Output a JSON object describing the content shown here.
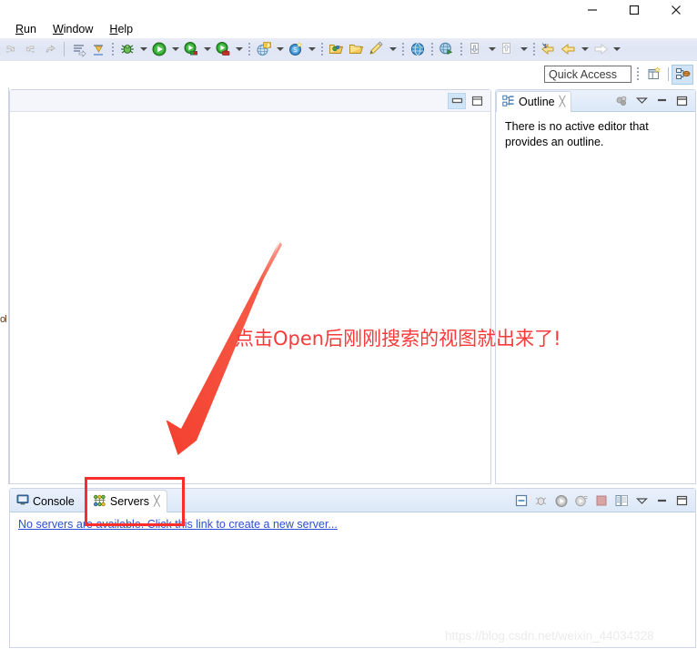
{
  "window": {
    "controls": [
      {
        "name": "minimize-button",
        "glyph": "minimize"
      },
      {
        "name": "maximize-button",
        "glyph": "maximize"
      },
      {
        "name": "close-button",
        "glyph": "close"
      }
    ]
  },
  "menubar": {
    "items": [
      {
        "label": "Run",
        "mnemonic": "R",
        "rest": "un"
      },
      {
        "label": "Window",
        "mnemonic": "W",
        "rest": "indow"
      },
      {
        "label": "Help",
        "mnemonic": "H",
        "rest": "elp"
      }
    ]
  },
  "toolbar": {
    "items": [
      {
        "name": "undo-icon",
        "kind": "icon"
      },
      {
        "name": "redo-icon",
        "kind": "icon"
      },
      {
        "name": "last-edit-location-icon",
        "kind": "icon"
      },
      {
        "name": "separator",
        "kind": "sep-line"
      },
      {
        "name": "next-annotation-icon",
        "kind": "icon"
      },
      {
        "name": "previous-annotation-icon",
        "kind": "icon"
      },
      {
        "name": "separator",
        "kind": "sep-dot"
      },
      {
        "name": "debug-icon",
        "kind": "icon"
      },
      {
        "name": "debug-dropdown-arrow-icon",
        "kind": "arrow"
      },
      {
        "name": "run-icon",
        "kind": "icon"
      },
      {
        "name": "run-dropdown-arrow-icon",
        "kind": "arrow"
      },
      {
        "name": "run-external-tools-icon",
        "kind": "icon"
      },
      {
        "name": "run-external-dropdown-arrow-icon",
        "kind": "arrow"
      },
      {
        "name": "run-on-server-icon",
        "kind": "icon"
      },
      {
        "name": "run-on-server-dropdown-arrow-icon",
        "kind": "arrow"
      },
      {
        "name": "separator",
        "kind": "sep-dot"
      },
      {
        "name": "new-web-project-icon",
        "kind": "icon"
      },
      {
        "name": "new-web-project-dropdown-arrow-icon",
        "kind": "arrow"
      },
      {
        "name": "search-icon",
        "kind": "icon"
      },
      {
        "name": "search-dropdown-arrow-icon",
        "kind": "arrow"
      },
      {
        "name": "separator",
        "kind": "sep-dot"
      },
      {
        "name": "open-type-icon",
        "kind": "icon"
      },
      {
        "name": "open-task-icon",
        "kind": "icon"
      },
      {
        "name": "new-annotation-icon",
        "kind": "icon"
      },
      {
        "name": "new-annotation-dropdown-arrow-icon",
        "kind": "arrow"
      },
      {
        "name": "separator",
        "kind": "sep-dot"
      },
      {
        "name": "open-web-browser-icon",
        "kind": "icon"
      },
      {
        "name": "separator",
        "kind": "sep-dot"
      },
      {
        "name": "open-perspective-icon",
        "kind": "icon"
      },
      {
        "name": "separator",
        "kind": "sep-dot"
      },
      {
        "name": "import-icon",
        "kind": "icon"
      },
      {
        "name": "import-dropdown-arrow-icon",
        "kind": "arrow"
      },
      {
        "name": "export-icon",
        "kind": "icon"
      },
      {
        "name": "export-dropdown-arrow-icon",
        "kind": "arrow"
      },
      {
        "name": "separator",
        "kind": "sep-dot"
      },
      {
        "name": "back-to-icon",
        "kind": "icon"
      },
      {
        "name": "back-icon",
        "kind": "icon"
      },
      {
        "name": "back-dropdown-arrow-icon",
        "kind": "arrow"
      },
      {
        "name": "forward-icon",
        "kind": "icon"
      },
      {
        "name": "forward-dropdown-arrow-icon",
        "kind": "arrow"
      }
    ]
  },
  "quick_access": {
    "placeholder": "Quick Access",
    "value": "Quick Access"
  },
  "perspective_bar": {
    "buttons": [
      {
        "name": "open-perspective-button",
        "active": false
      },
      {
        "name": "java-ee-perspective-button",
        "active": true
      }
    ]
  },
  "left_fast_view": {
    "clipped_label": "ol"
  },
  "editor_area": {
    "controls": [
      {
        "name": "restore-editor-button",
        "glyph": "restore",
        "active": true
      },
      {
        "name": "maximize-editor-button",
        "glyph": "maximize",
        "active": false
      }
    ],
    "body_text": ""
  },
  "outline_view": {
    "tab": {
      "title": "Outline",
      "icon": "outline-icon",
      "close": "╳"
    },
    "tools": [
      {
        "name": "focus-on-selection-icon"
      },
      {
        "name": "view-menu-icon"
      },
      {
        "name": "minimize-view-icon"
      },
      {
        "name": "maximize-view-icon"
      }
    ],
    "message": "There is no active editor that provides an outline."
  },
  "bottom_view": {
    "tabs": [
      {
        "label": "Console",
        "icon": "console-icon",
        "active": false,
        "closable": false
      },
      {
        "label": "Servers",
        "icon": "servers-icon",
        "active": true,
        "closable": true,
        "close": "╳"
      }
    ],
    "tools": [
      {
        "name": "new-server-icon"
      },
      {
        "name": "debug-server-icon"
      },
      {
        "name": "start-server-icon"
      },
      {
        "name": "profile-server-icon"
      },
      {
        "name": "stop-server-icon"
      },
      {
        "name": "publish-server-icon"
      },
      {
        "name": "view-menu-icon"
      },
      {
        "name": "minimize-view-icon"
      },
      {
        "name": "maximize-view-icon"
      }
    ],
    "empty_link": "No servers are available. Click this link to create a new server..."
  },
  "annotations": {
    "callout_text": "点击Open后刚刚搜索的视图就出来了!",
    "callout_color": "#f83a3a",
    "highlight_box_color": "#fa2d2d",
    "arrow_color": "#f4402f"
  },
  "watermark": {
    "text": "https://blog.csdn.net/weixin_44034328"
  }
}
